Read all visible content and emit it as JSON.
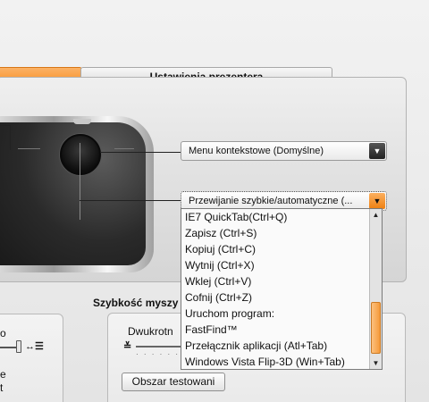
{
  "tabs": {
    "active_label": "",
    "presenter_label": "Ustawienia prezentera"
  },
  "mouse": {
    "dropdown_wheel_click": {
      "value": "Menu kontekstowe (Domyślne)"
    },
    "dropdown_wheel_tilt": {
      "value": "Przewijanie  szybkie/automatyczne (...",
      "options": [
        "IE7 QuickTab(Ctrl+Q)",
        "Zapisz (Ctrl+S)",
        "Kopiuj (Ctrl+C)",
        "Wytnij (Ctrl+X)",
        "Wklej (Ctrl+V)",
        "Cofnij (Ctrl+Z)",
        "Uruchom program:",
        "FastFind™",
        "Przełącznik aplikacji (Atl+Tab)",
        "Windows Vista Flip-3D (Win+Tab)"
      ]
    }
  },
  "speed": {
    "title": "Szybkość myszy",
    "double_click_label": "Dwukrotn",
    "test_button": "Obszar testowani"
  },
  "left_fragment": {
    "line1": "o",
    "line2": "e",
    "line3": "t",
    "icon_glyph": "↔☰"
  },
  "icons": {
    "dropdown": "▼",
    "scroll_up": "▲",
    "scroll_down": "▼",
    "slow": "≚"
  },
  "colors": {
    "accent": "#f78c22",
    "dark": "#222222"
  }
}
